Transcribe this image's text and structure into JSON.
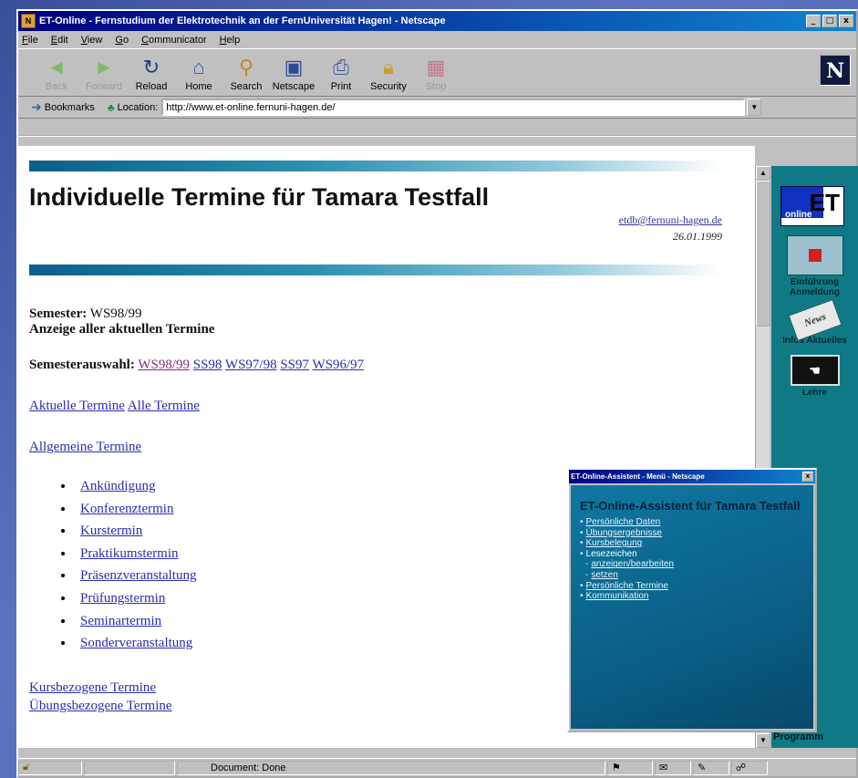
{
  "window": {
    "title": "ET-Online - Fernstudium der Elektrotechnik an der FernUniversität Hagen! - Netscape",
    "controls": [
      "_",
      "□",
      "x"
    ]
  },
  "menu": [
    "File",
    "Edit",
    "View",
    "Go",
    "Communicator",
    "Help"
  ],
  "nav_buttons": [
    {
      "label": "Back",
      "icon": "back-arrow-icon",
      "enabled": false
    },
    {
      "label": "Forward",
      "icon": "forward-arrow-icon",
      "enabled": false
    },
    {
      "label": "Reload",
      "icon": "reload-icon",
      "enabled": true
    },
    {
      "label": "Home",
      "icon": "home-icon",
      "enabled": true
    },
    {
      "label": "Search",
      "icon": "search-icon",
      "enabled": true
    },
    {
      "label": "Netscape",
      "icon": "netscape-icon",
      "enabled": true
    },
    {
      "label": "Print",
      "icon": "print-icon",
      "enabled": true
    },
    {
      "label": "Security",
      "icon": "security-lock-icon",
      "enabled": true
    },
    {
      "label": "Stop",
      "icon": "stop-icon",
      "enabled": false
    }
  ],
  "location": {
    "bookmarks_label": "Bookmarks",
    "location_label": "Location:",
    "url": "http://www.et-online.fernuni-hagen.de/"
  },
  "page": {
    "heading": "Individuelle Termine für Tamara Testfall",
    "email": "etdb@fernuni-hagen.de",
    "date": "26.01.1999",
    "semester_label": "Semester:",
    "semester_value": "WS98/99",
    "anzeige": "Anzeige aller aktuellen Termine",
    "semesterauswahl_label": "Semesterauswahl:",
    "semesters": [
      "WS98/99",
      "SS98",
      "WS97/98",
      "SS97",
      "WS96/97"
    ],
    "filter_links": [
      "Aktuelle Termine",
      "Alle Termine"
    ],
    "allgemeine": "Allgemeine Termine",
    "types": [
      "Ankündigung",
      "Konferenztermin",
      "Kurstermin",
      "Praktikumstermin",
      "Präsenzveranstaltung",
      "Prüfungstermin",
      "Seminartermin",
      "Sonderveranstaltung"
    ],
    "kursbezogene": "Kursbezogene Termine",
    "uebungsbezogene": "Übungsbezogene Termine"
  },
  "side_frame": {
    "logo": "ET",
    "logo_sub": "online",
    "items": [
      {
        "label": "Einführung Anmeldung"
      },
      {
        "label": "Infos Aktuelles",
        "badge": "News"
      },
      {
        "label": "Lehre"
      }
    ],
    "bottom_label": "Programm"
  },
  "popup": {
    "title": "ET-Online-Assistent - Menü - Netscape",
    "heading": "ET-Online-Assistent für Tamara Testfall",
    "items": [
      {
        "text": "Persönliche Daten",
        "link": true
      },
      {
        "text": "Übungsergebnisse",
        "link": true
      },
      {
        "text": "Kursbelegung",
        "link": true
      },
      {
        "text": "Lesezeichen",
        "link": false
      },
      {
        "text": "anzeigen/bearbeiten",
        "link": true,
        "sub": true
      },
      {
        "text": "setzen",
        "link": true,
        "sub": true
      },
      {
        "text": "Persönliche Termine",
        "link": true
      },
      {
        "text": "Kommunikation",
        "link": true
      }
    ]
  },
  "status": {
    "text": "Document: Done"
  }
}
